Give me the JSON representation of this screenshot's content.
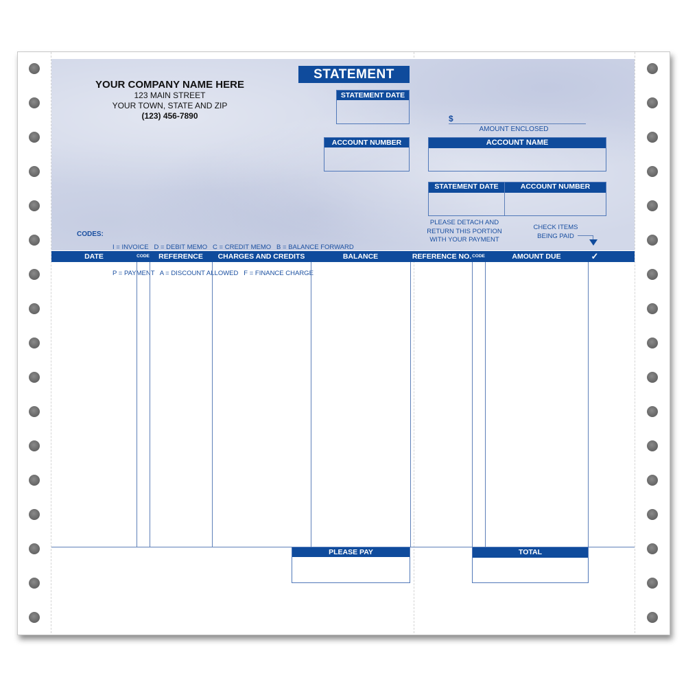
{
  "company": {
    "name": "YOUR COMPANY NAME HERE",
    "street": "123 MAIN STREET",
    "city_state_zip": "YOUR TOWN, STATE AND ZIP",
    "phone": "(123) 456-7890"
  },
  "form_title": "STATEMENT",
  "top_fields": {
    "statement_date": "STATEMENT DATE",
    "account_number": "ACCOUNT NUMBER"
  },
  "remittance": {
    "currency_symbol": "$",
    "amount_enclosed_label": "AMOUNT ENCLOSED",
    "account_name": "ACCOUNT NAME",
    "statement_date": "STATEMENT DATE",
    "account_number": "ACCOUNT NUMBER",
    "detach_note": [
      "PLEASE DETACH AND",
      "RETURN THIS PORTION",
      "WITH YOUR PAYMENT"
    ],
    "check_note": [
      "CHECK ITEMS",
      "BEING PAID"
    ]
  },
  "codes": {
    "label": "CODES:",
    "line1": "I = INVOICE   D = DEBIT MEMO   C = CREDIT MEMO   B = BALANCE FORWARD",
    "line2": "P = PAYMENT   A = DISCOUNT ALLOWED   F = FINANCE CHARGE"
  },
  "table": {
    "left_columns": [
      "DATE",
      "CODE",
      "REFERENCE",
      "CHARGES AND CREDITS",
      "BALANCE"
    ],
    "right_columns": [
      "REFERENCE NO.",
      "CODE",
      "AMOUNT DUE",
      "✓"
    ]
  },
  "totals": {
    "please_pay": "PLEASE PAY",
    "total": "TOTAL"
  },
  "colors": {
    "form_blue": "#0f4b9c",
    "line_blue": "#5d7fb8",
    "parchment": "#d2d8e9"
  }
}
